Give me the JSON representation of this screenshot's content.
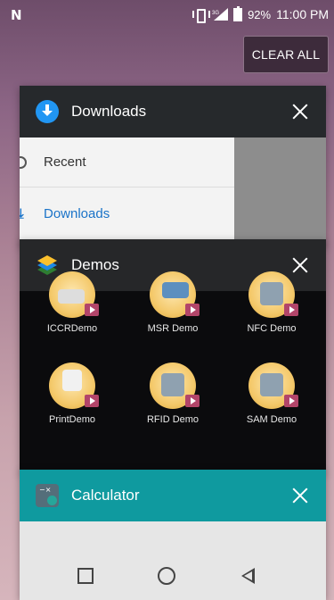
{
  "status_bar": {
    "notification_icon": "N",
    "battery_percent": "92%",
    "time": "11:00 PM",
    "network_label": "3G"
  },
  "clear_all": {
    "label": "CLEAR ALL"
  },
  "recents": [
    {
      "app": "Downloads",
      "icon": "download-icon",
      "drawer_items": [
        {
          "label": "Recent",
          "icon": "clock-icon"
        },
        {
          "label": "Downloads",
          "icon": "download-arrow-icon",
          "selected": true
        }
      ]
    },
    {
      "app": "Demos",
      "icon": "layers-icon",
      "apps": [
        {
          "label": "ICCRDemo",
          "icon": "card-reader-icon"
        },
        {
          "label": "MSR Demo",
          "icon": "magstripe-icon"
        },
        {
          "label": "NFC Demo",
          "icon": "nfc-icon"
        },
        {
          "label": "PrintDemo",
          "icon": "printer-icon"
        },
        {
          "label": "RFID Demo",
          "icon": "rfid-icon"
        },
        {
          "label": "SAM Demo",
          "icon": "sam-card-icon"
        }
      ]
    },
    {
      "app": "Calculator",
      "icon": "calculator-icon"
    }
  ],
  "colors": {
    "downloads_accent": "#2196f3",
    "calculator_header": "#0f9a9f",
    "demos_header": "#262729"
  }
}
